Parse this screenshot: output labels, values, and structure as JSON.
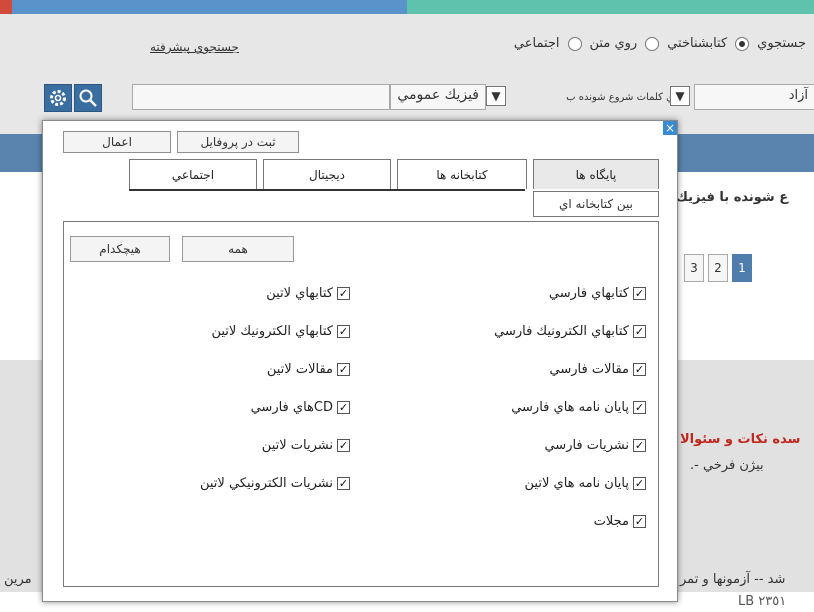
{
  "search": {
    "search_label": "جستجوي",
    "radio_options": [
      {
        "label": "كتابشناختي",
        "selected": true
      },
      {
        "label": "روي متن",
        "selected": false
      },
      {
        "label": "اجتماعي",
        "selected": false
      }
    ],
    "advanced_link": "جستجوي پيشرفته",
    "term_value": "فيزيك عمومي",
    "mode_value": "حاوي كلمات شروع شونده ب",
    "free_value": "آزاد"
  },
  "background": {
    "text_found": "ع شونده با فيزيك",
    "text_red": "سده نكات و سئوالا",
    "text_author": "بيژن فرخي -.",
    "text_bottom": "شد -- آزمونها و تمر",
    "text_bottom_left": "مرين",
    "text_call": "LB  ٢٣٥١",
    "pages": [
      "1",
      "2",
      "3"
    ],
    "active_page": "1"
  },
  "modal": {
    "close_glyph": "×",
    "apply_label": "اعمال",
    "save_profile_label": "ثبت در پروفايل",
    "tabs": {
      "databases": "پايگاه ها",
      "libraries": "كتابخانه ها",
      "digital": "ديجيتال",
      "social": "اجتماعي",
      "interlibrary": "بين كتابخانه اي"
    },
    "all_label": "همه",
    "none_label": "هيچكدام",
    "right_items": [
      "كتابهاي فارسي",
      "كتابهاي الكترونيك فارسي",
      "مقالات فارسي",
      "پايان نامه هاي فارسي",
      "نشريات فارسي",
      "پايان نامه هاي لاتين",
      "مجلات"
    ],
    "left_items": [
      "كتابهاي لاتين",
      "كتابهاي الكترونيك لاتين",
      "مقالات لاتين",
      "CDهاي فارسي",
      "نشريات لاتين",
      "نشريات الكترونيكي لاتين"
    ],
    "check_glyph": "✓"
  },
  "colors": {
    "accent_blue": "#3a6da0",
    "top_strip_blue": "#5a93c9",
    "top_strip_green": "#5ec2ad",
    "red_text": "#c0281e"
  }
}
